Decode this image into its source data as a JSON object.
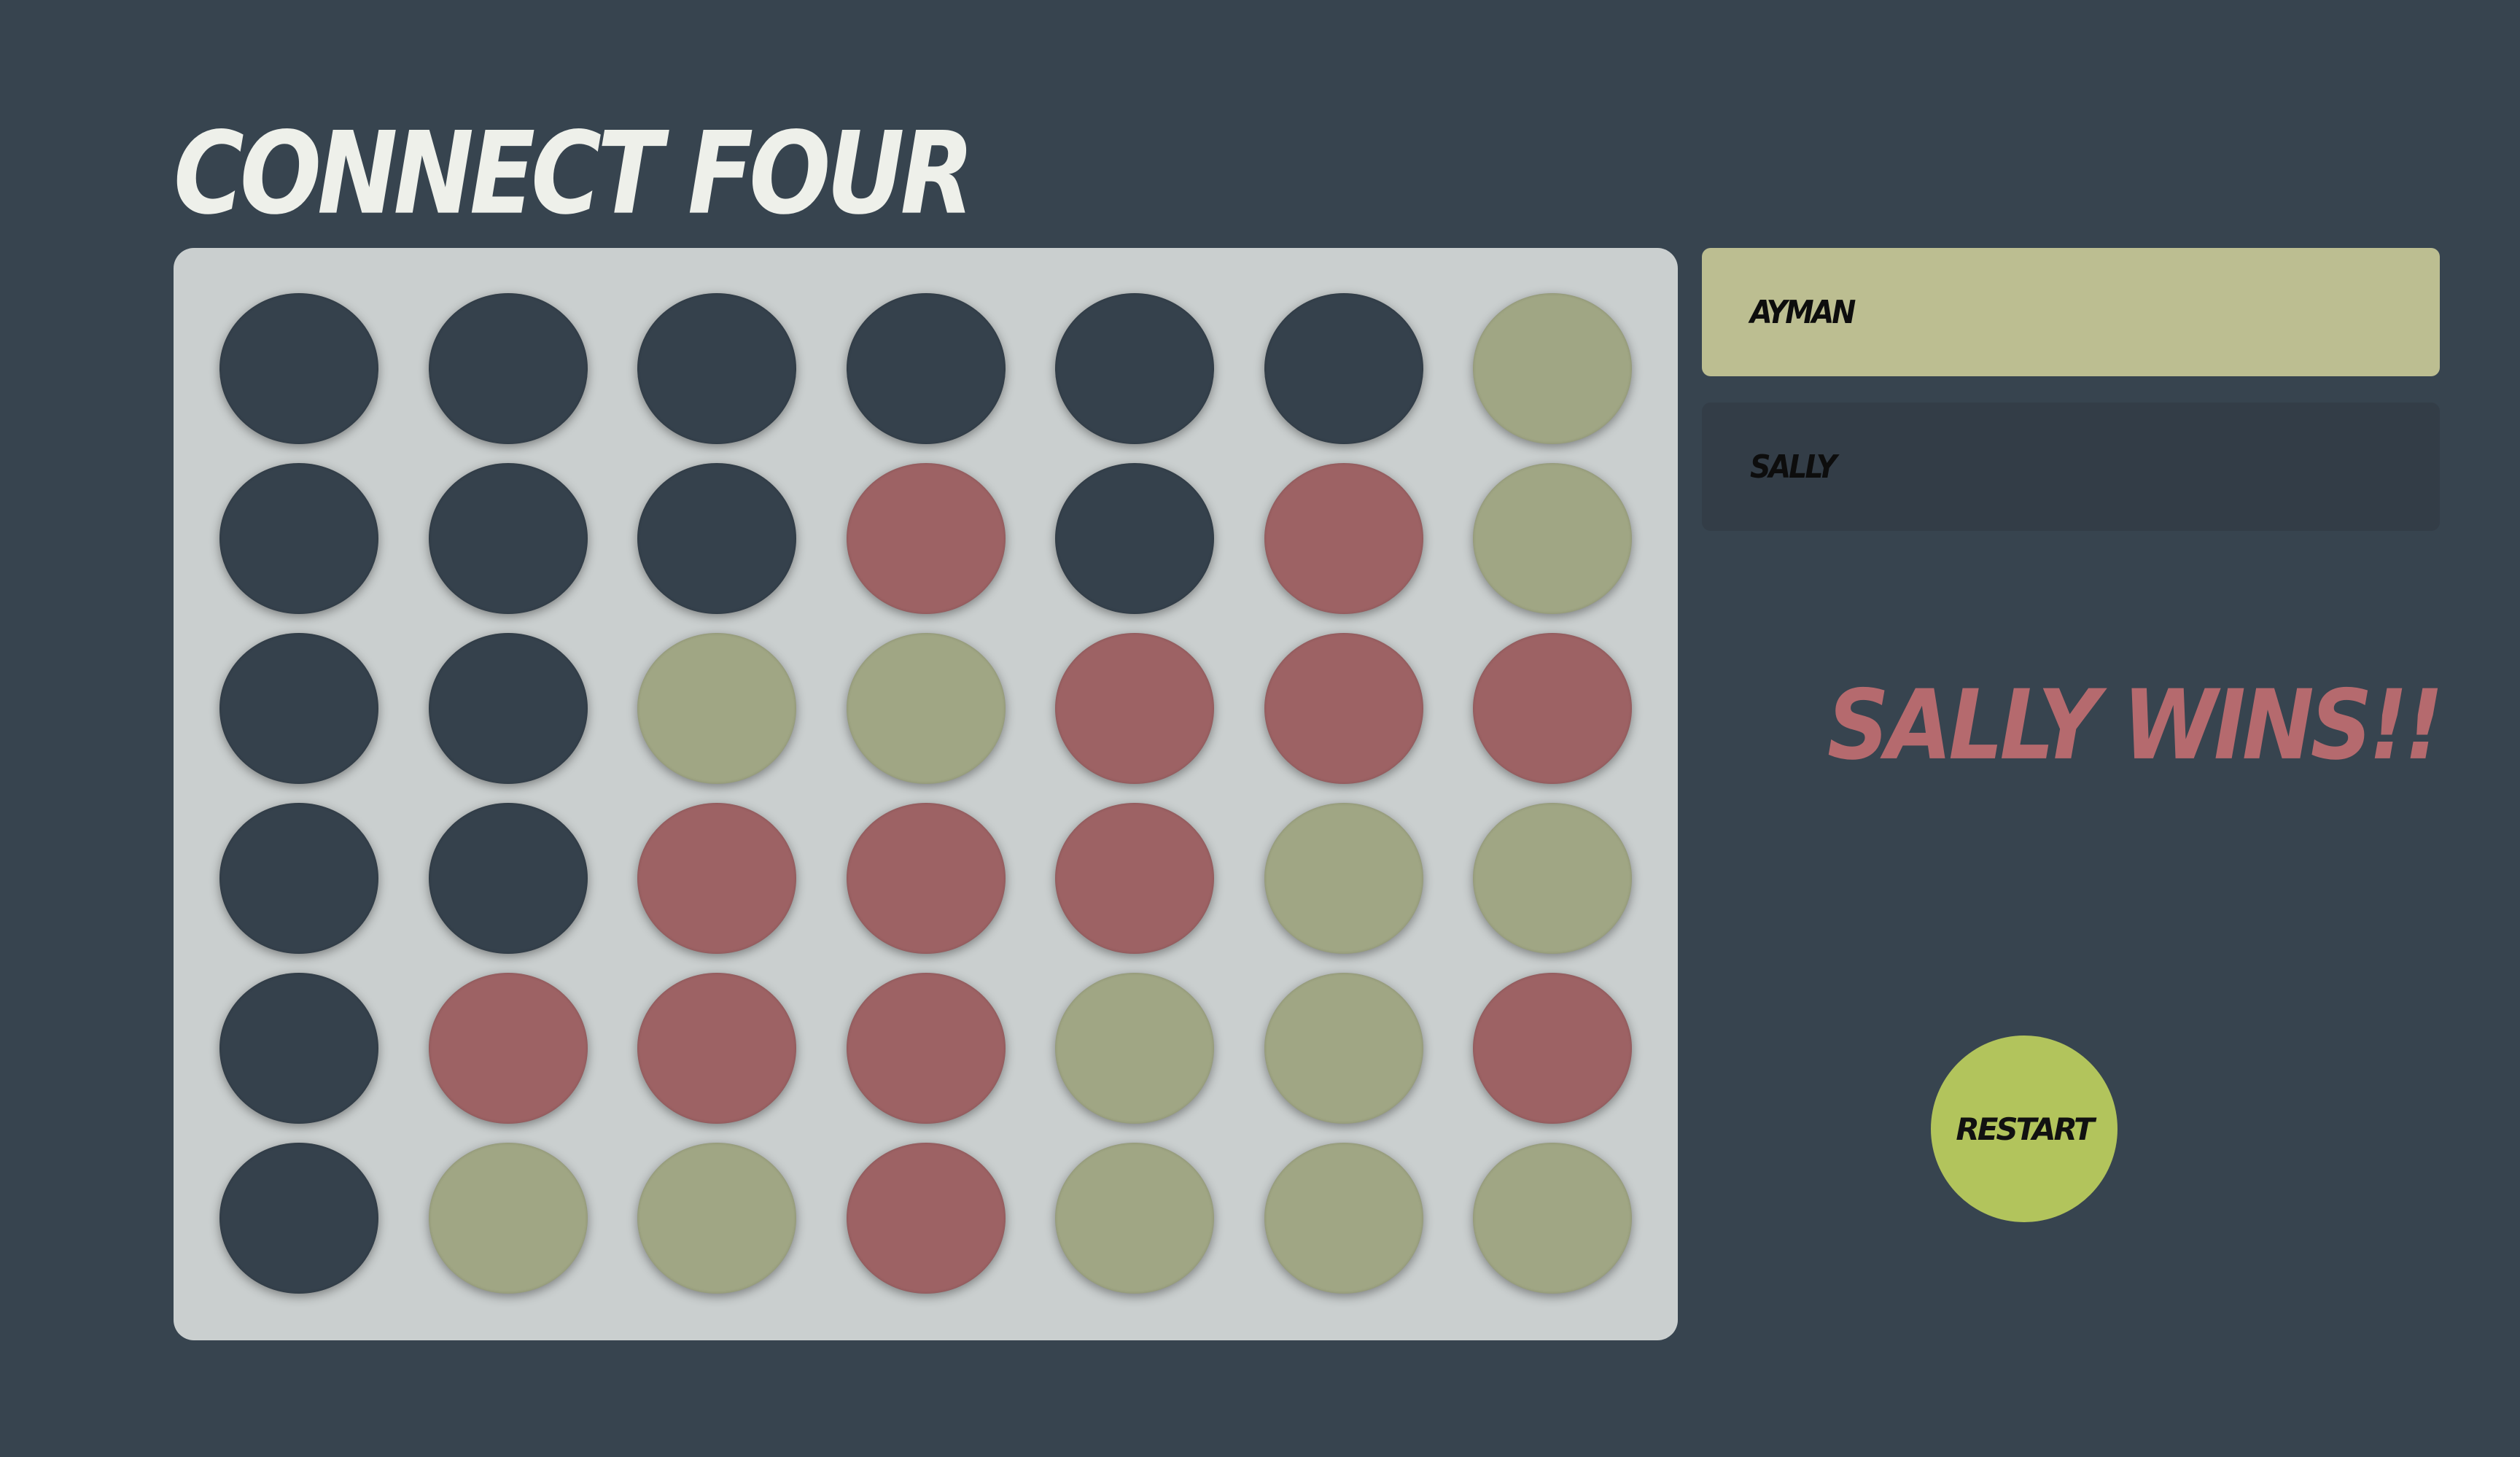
{
  "app": {
    "title": "CONNECT FOUR"
  },
  "players": [
    {
      "name": "AYMAN",
      "active": true
    },
    {
      "name": "SALLY",
      "active": false
    }
  ],
  "status": {
    "message": "SALLY WINS!!"
  },
  "controls": {
    "restart_label": "RESTART"
  },
  "board": {
    "columns": 7,
    "rows": 6,
    "cells": [
      [
        "empty",
        "empty",
        "empty",
        "empty",
        "empty",
        "empty",
        "olive"
      ],
      [
        "empty",
        "empty",
        "empty",
        "red",
        "empty",
        "red",
        "olive"
      ],
      [
        "empty",
        "empty",
        "olive",
        "olive",
        "red",
        "red",
        "red"
      ],
      [
        "empty",
        "empty",
        "red",
        "red",
        "red",
        "olive",
        "olive"
      ],
      [
        "empty",
        "red",
        "red",
        "red",
        "olive",
        "olive",
        "red"
      ],
      [
        "empty",
        "olive",
        "olive",
        "red",
        "olive",
        "olive",
        "olive"
      ]
    ]
  },
  "colors": {
    "background": "#37444f",
    "board": "#cacfcf",
    "empty_slot": "#35414c",
    "red_piece": "#9d6264",
    "olive_piece": "#a0a684",
    "active_player_bg": "#bcbe91",
    "inactive_player_bg": "#333d47",
    "win_text": "#b56a6e",
    "restart_button": "#b2c45c"
  }
}
